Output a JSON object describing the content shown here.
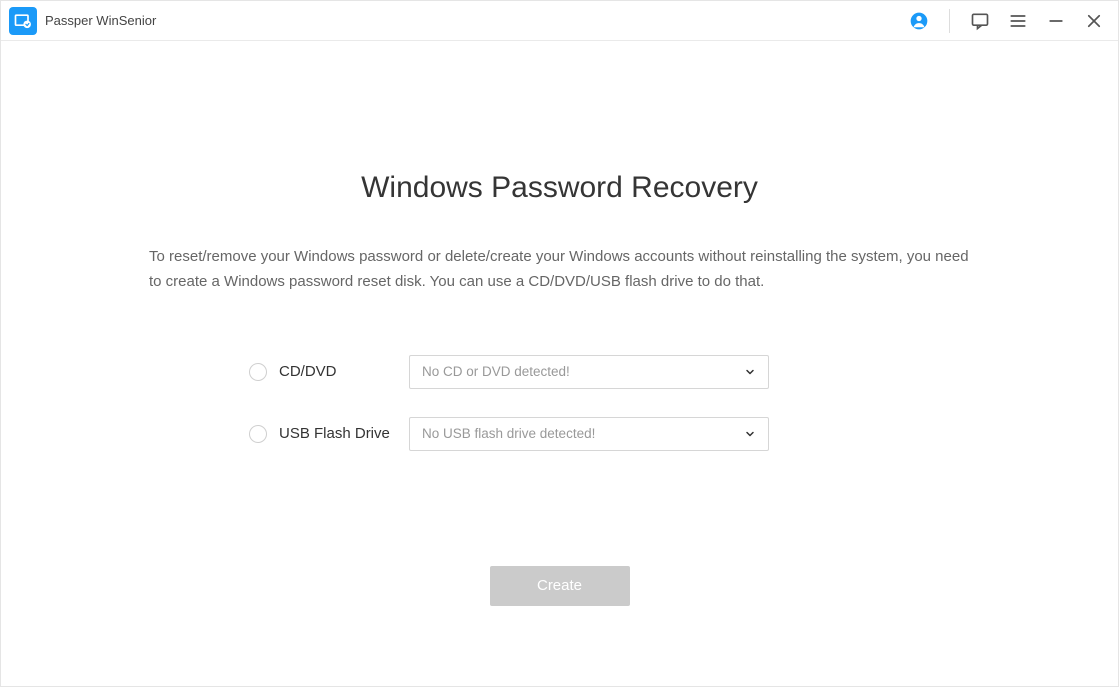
{
  "titlebar": {
    "app_name": "Passper WinSenior"
  },
  "main": {
    "heading": "Windows Password Recovery",
    "description": "To reset/remove your Windows password or delete/create your Windows accounts without reinstalling the system, you need to create a Windows password reset disk. You can use a CD/DVD/USB flash drive to do that.",
    "options": {
      "cd_dvd": {
        "label": "CD/DVD",
        "placeholder": "No CD or DVD detected!"
      },
      "usb": {
        "label": "USB Flash Drive",
        "placeholder": "No USB flash drive detected!"
      }
    },
    "create_button": "Create"
  }
}
